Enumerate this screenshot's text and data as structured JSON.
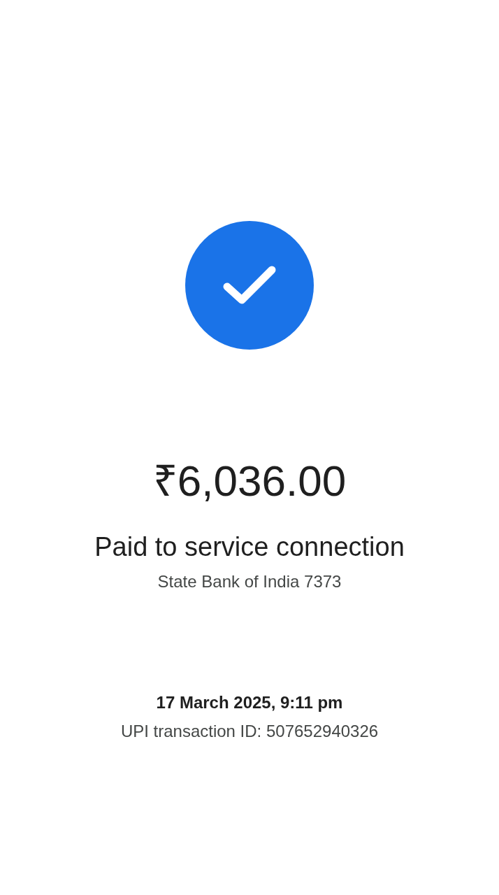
{
  "status": {
    "kind": "success"
  },
  "amount": "₹6,036.00",
  "recipient": "Paid to service connection",
  "account": "State Bank of India 7373",
  "datetime": "17 March 2025, 9:11 pm",
  "transaction_id": "UPI transaction ID: 507652940326"
}
